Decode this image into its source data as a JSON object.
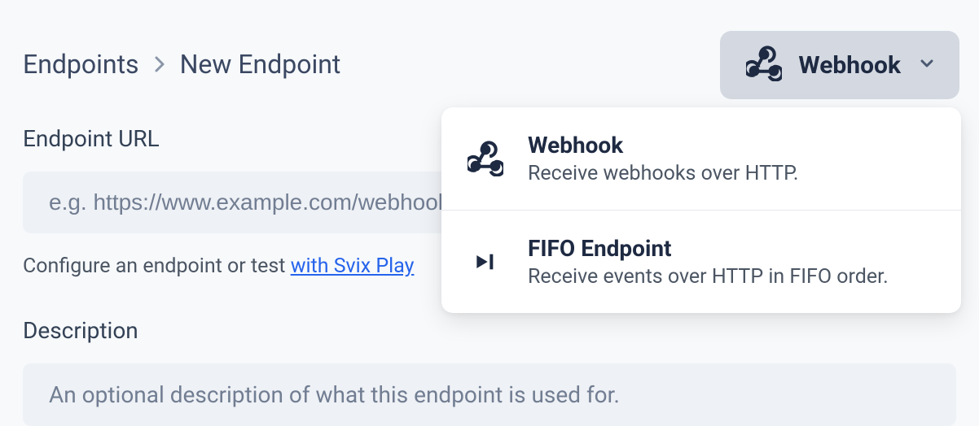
{
  "breadcrumb": {
    "root": "Endpoints",
    "current": "New Endpoint"
  },
  "typeSelector": {
    "selected": "Webhook"
  },
  "dropdown": {
    "items": [
      {
        "title": "Webhook",
        "description": "Receive webhooks over HTTP."
      },
      {
        "title": "FIFO Endpoint",
        "description": "Receive events over HTTP in FIFO order."
      }
    ]
  },
  "fields": {
    "url": {
      "label": "Endpoint URL",
      "placeholder": "e.g. https://www.example.com/webhook/",
      "helper_prefix": "Configure an endpoint or test ",
      "helper_link": "with Svix Play"
    },
    "description": {
      "label": "Description",
      "placeholder": "An optional description of what this endpoint is used for."
    }
  }
}
